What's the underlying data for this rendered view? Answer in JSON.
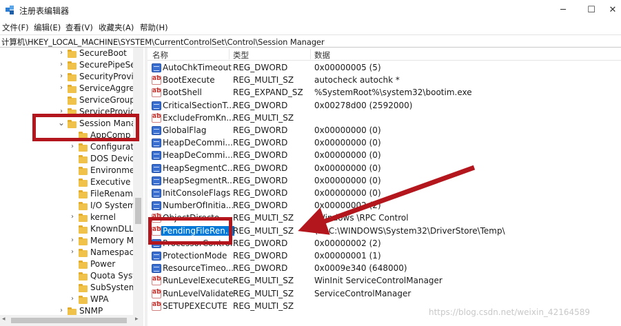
{
  "window": {
    "title": "注册表编辑器"
  },
  "menu": [
    "文件(F)",
    "编辑(E)",
    "查看(V)",
    "收藏夹(A)",
    "帮助(H)"
  ],
  "address": "计算机\\HKEY_LOCAL_MACHINE\\SYSTEM\\CurrentControlSet\\Control\\Session Manager",
  "tree": [
    {
      "label": "SecureBoot",
      "chevron": "›"
    },
    {
      "label": "SecurePipeSer",
      "chevron": "›"
    },
    {
      "label": "SecurityProvid",
      "chevron": "›"
    },
    {
      "label": "ServiceAggreg",
      "chevron": "›"
    },
    {
      "label": "ServiceGroupO",
      "chevron": ""
    },
    {
      "label": "ServiceProvide",
      "chevron": "›"
    },
    {
      "label": "Session Mana",
      "chevron": "⌄"
    },
    {
      "label": "AppComp",
      "chevron": ""
    },
    {
      "label": "Configurat",
      "chevron": "›"
    },
    {
      "label": "DOS Device",
      "chevron": ""
    },
    {
      "label": "Environme",
      "chevron": ""
    },
    {
      "label": "Executive",
      "chevron": ""
    },
    {
      "label": "FileRename",
      "chevron": ""
    },
    {
      "label": "I/O System",
      "chevron": ""
    },
    {
      "label": "kernel",
      "chevron": "›"
    },
    {
      "label": "KnownDLLs",
      "chevron": ""
    },
    {
      "label": "Memory M",
      "chevron": "›"
    },
    {
      "label": "Namespac",
      "chevron": "›"
    },
    {
      "label": "Power",
      "chevron": ""
    },
    {
      "label": "Quota Syst",
      "chevron": ""
    },
    {
      "label": "SubSystem",
      "chevron": ""
    },
    {
      "label": "WPA",
      "chevron": "›"
    },
    {
      "label": "SNMP",
      "chevron": "›"
    }
  ],
  "columns": {
    "name": "名称",
    "type": "类型",
    "data": "数据"
  },
  "values": [
    {
      "name": "AutoChkTimeout",
      "type": "REG_DWORD",
      "data": "0x00000005 (5)",
      "icon": "dword"
    },
    {
      "name": "BootExecute",
      "type": "REG_MULTI_SZ",
      "data": "autocheck autochk *",
      "icon": "sz"
    },
    {
      "name": "BootShell",
      "type": "REG_EXPAND_SZ",
      "data": "%SystemRoot%\\system32\\bootim.exe",
      "icon": "sz"
    },
    {
      "name": "CriticalSectionT...",
      "type": "REG_DWORD",
      "data": "0x00278d00 (2592000)",
      "icon": "dword"
    },
    {
      "name": "ExcludeFromKn...",
      "type": "REG_MULTI_SZ",
      "data": "",
      "icon": "sz"
    },
    {
      "name": "GlobalFlag",
      "type": "REG_DWORD",
      "data": "0x00000000 (0)",
      "icon": "dword"
    },
    {
      "name": "HeapDeCommi...",
      "type": "REG_DWORD",
      "data": "0x00000000 (0)",
      "icon": "dword"
    },
    {
      "name": "HeapDeCommi...",
      "type": "REG_DWORD",
      "data": "0x00000000 (0)",
      "icon": "dword"
    },
    {
      "name": "HeapSegmentC...",
      "type": "REG_DWORD",
      "data": "0x00000000 (0)",
      "icon": "dword"
    },
    {
      "name": "HeapSegmentR...",
      "type": "REG_DWORD",
      "data": "0x00000000 (0)",
      "icon": "dword"
    },
    {
      "name": "InitConsoleFlags",
      "type": "REG_DWORD",
      "data": "0x00000000 (0)",
      "icon": "dword"
    },
    {
      "name": "NumberOfInitia...",
      "type": "REG_DWORD",
      "data": "0x00000002 (2)",
      "icon": "dword"
    },
    {
      "name": "ObjectDirecto...",
      "type": "REG_MULTI_SZ",
      "data": "\\Windows \\RPC Control",
      "icon": "sz"
    },
    {
      "name": "PendingFileRen...",
      "type": "REG_MULTI_SZ",
      "data": "\\??\\C:\\WINDOWS\\System32\\DriverStore\\Temp\\",
      "icon": "sz",
      "selected": true
    },
    {
      "name": "ProcessorControl",
      "type": "REG_DWORD",
      "data": "0x00000002 (2)",
      "icon": "dword"
    },
    {
      "name": "ProtectionMode",
      "type": "REG_DWORD",
      "data": "0x00000001 (1)",
      "icon": "dword"
    },
    {
      "name": "ResourceTimeo...",
      "type": "REG_DWORD",
      "data": "0x0009e340 (648000)",
      "icon": "dword"
    },
    {
      "name": "RunLevelExecute",
      "type": "REG_MULTI_SZ",
      "data": "WinInit ServiceControlManager",
      "icon": "sz"
    },
    {
      "name": "RunLevelValidate",
      "type": "REG_MULTI_SZ",
      "data": "ServiceControlManager",
      "icon": "sz"
    },
    {
      "name": "SETUPEXECUTE",
      "type": "REG_MULTI_SZ",
      "data": "",
      "icon": "sz"
    }
  ],
  "watermark": "https://blog.csdn.net/weixin_42164589",
  "colors": {
    "annotation": "#b3171d",
    "selection": "#0078d7",
    "folder": "#f0c24a",
    "dword_icon": "#3a6fd0"
  }
}
